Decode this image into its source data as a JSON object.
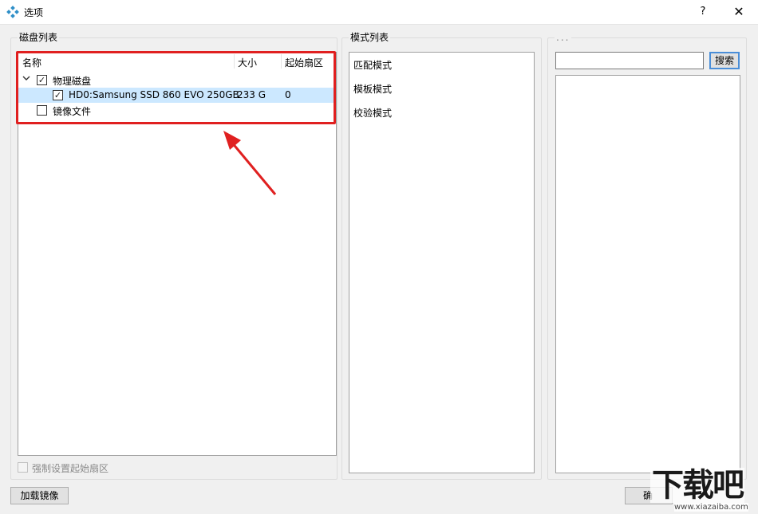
{
  "window": {
    "title": "选项",
    "help_label": "?",
    "close_label": "✕",
    "icon": "app-diamond-icon"
  },
  "disk_panel": {
    "group_title": "磁盘列表",
    "columns": [
      "名称",
      "大小",
      "起始扇区"
    ],
    "tree": [
      {
        "label": "物理磁盘",
        "expanded": true,
        "checked": true,
        "size": "",
        "start_sector": ""
      },
      {
        "label": "HD0:Samsung SSD 860 EVO 250GB",
        "checked": true,
        "size": "233 G",
        "start_sector": "0",
        "selected": true
      },
      {
        "label": "镜像文件",
        "checked": false,
        "size": "",
        "start_sector": ""
      }
    ],
    "force_sector_label": "强制设置起始扇区",
    "force_sector_checked": false
  },
  "mode_panel": {
    "group_title": "模式列表",
    "items": [
      "匹配模式",
      "模板模式",
      "校验模式"
    ]
  },
  "right_panel": {
    "group_title": "...",
    "search_value": "",
    "search_button": "搜索"
  },
  "footer": {
    "load_image_button": "加载镜像",
    "ok_button_partial": "确"
  },
  "annotation": {
    "highlight_color": "#e02020"
  },
  "watermark": {
    "text": "下载吧",
    "url": "www.xiazaiba.com"
  }
}
